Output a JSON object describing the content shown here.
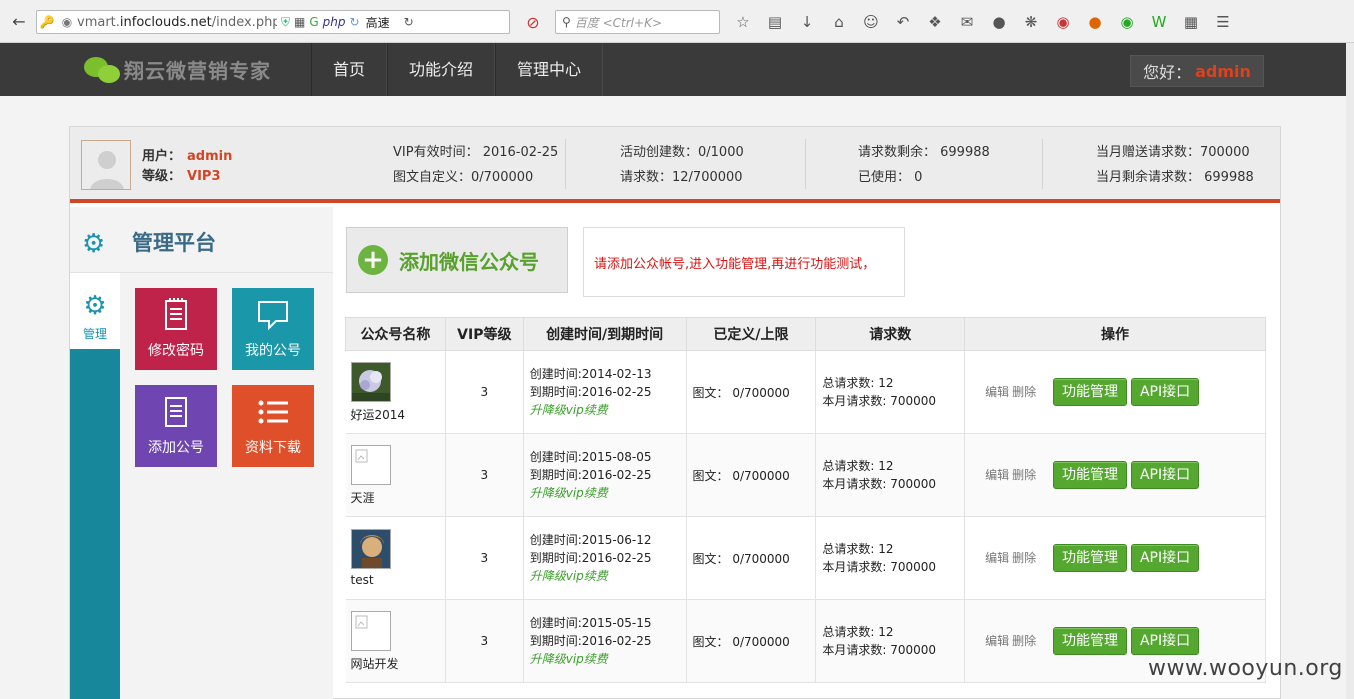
{
  "browser": {
    "url_prefix": "vmart.",
    "url_domain": "infoclouds.net",
    "url_path": "/index.php?&",
    "speed_label": "高速",
    "search_placeholder": "百度 <Ctrl+K>"
  },
  "header": {
    "logo_text": "翔云微营销专家",
    "nav": [
      "首页",
      "功能介绍",
      "管理中心"
    ],
    "greeting": "您好：",
    "username": "admin"
  },
  "userbar": {
    "user_label": "用户：",
    "user_value": "admin",
    "level_label": "等级：",
    "level_value": "VIP3",
    "stats": [
      [
        "VIP有效时间： 2016-02-25",
        "图文自定义：0/700000"
      ],
      [
        "活动创建数：0/1000",
        "请求数：12/700000"
      ],
      [
        "请求数剩余： 699988",
        "已使用： 0"
      ],
      [
        "当月赠送请求数：700000",
        "当月剩余请求数： 699988"
      ]
    ]
  },
  "sidebar": {
    "title": "管理平台",
    "tab_label": "管理",
    "tiles": [
      {
        "label": "修改密码",
        "color": "#c0234a"
      },
      {
        "label": "我的公号",
        "color": "#1a97a8"
      },
      {
        "label": "添加公号",
        "color": "#6f45b1"
      },
      {
        "label": "资料下载",
        "color": "#de4f2a"
      }
    ]
  },
  "content": {
    "add_button": "添加微信公众号",
    "notice": "请添加公众帐号,进入功能管理,再进行功能测试，",
    "columns": [
      "公众号名称",
      "VIP等级",
      "创建时间/到期时间",
      "已定义/上限",
      "请求数",
      "操作"
    ],
    "rows": [
      {
        "name": "好运2014",
        "vip": "3",
        "created": "创建时间:2014-02-13",
        "expires": "到期时间:2016-02-25",
        "upgrade": "升降级vip续费",
        "defined": "图文： 0/700000",
        "total": "总请求数: 12",
        "monthly": "本月请求数: 700000"
      },
      {
        "name": "天涯",
        "vip": "3",
        "created": "创建时间:2015-08-05",
        "expires": "到期时间:2016-02-25",
        "upgrade": "升降级vip续费",
        "defined": "图文： 0/700000",
        "total": "总请求数: 12",
        "monthly": "本月请求数: 700000"
      },
      {
        "name": "test",
        "vip": "3",
        "created": "创建时间:2015-06-12",
        "expires": "到期时间:2016-02-25",
        "upgrade": "升降级vip续费",
        "defined": "图文： 0/700000",
        "total": "总请求数: 12",
        "monthly": "本月请求数: 700000"
      },
      {
        "name": "网站开发",
        "vip": "3",
        "created": "创建时间:2015-05-15",
        "expires": "到期时间:2016-02-25",
        "upgrade": "升降级vip续费",
        "defined": "图文： 0/700000",
        "total": "总请求数: 12",
        "monthly": "本月请求数: 700000"
      }
    ],
    "op_edit": "编辑",
    "op_delete": "删除",
    "op_manage": "功能管理",
    "op_api": "API接口"
  },
  "watermark": "www.wooyun.org"
}
